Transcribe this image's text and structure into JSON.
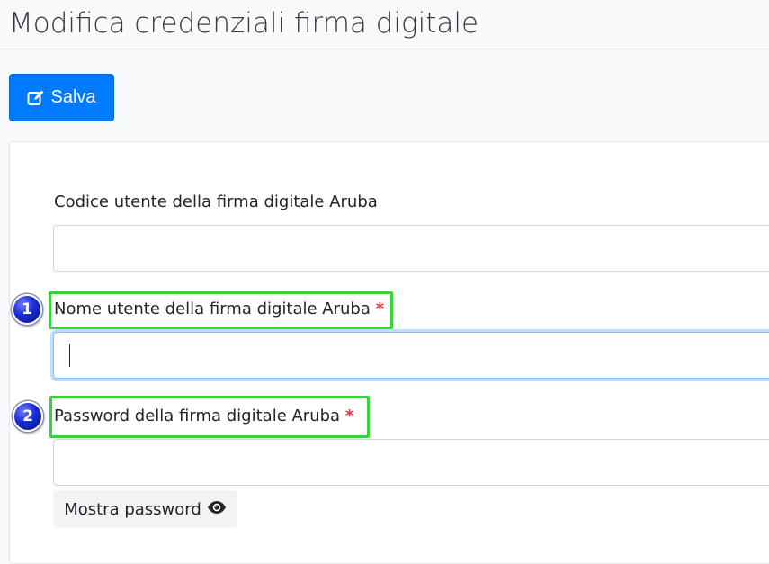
{
  "page": {
    "title": "Modifica credenziali firma digitale"
  },
  "toolbar": {
    "save_label": "Salva",
    "save_icon": "edit-icon",
    "save_color": "#007bff"
  },
  "form": {
    "fields": [
      {
        "label": "Codice utente della firma digitale Aruba",
        "required": false,
        "value": "",
        "focused": false
      },
      {
        "label": "Nome utente della firma digitale Aruba",
        "required": true,
        "required_mark": "*",
        "value": "",
        "focused": true,
        "step_number": "1"
      },
      {
        "label": "Password della firma digitale Aruba",
        "required": true,
        "required_mark": "*",
        "value": "",
        "focused": false,
        "step_number": "2"
      }
    ],
    "show_password_label": "Mostra password",
    "show_password_icon": "eye-icon"
  },
  "annotations": {
    "highlight_color": "#39d339",
    "badge_color": "#1b2bd6"
  }
}
